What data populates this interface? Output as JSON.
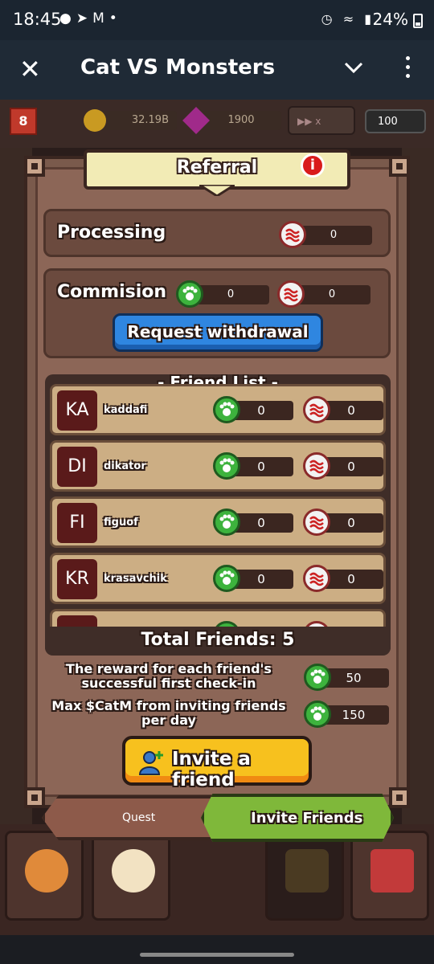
{
  "status_bar": {
    "time": "18:45",
    "battery": "24%"
  },
  "app_bar": {
    "title": "Cat VS Monsters"
  },
  "hud": {
    "level": "8",
    "coins": "32.19B",
    "gems": "1900",
    "speed": "x",
    "energy": "100"
  },
  "referral": {
    "title": "Referral",
    "info": "i",
    "processing_label": "Processing",
    "processing_value": "0",
    "commission_label": "Commision",
    "commission_green": "0",
    "commission_red": "0",
    "withdraw_button": "Request withdrawal",
    "friend_list_title": "- Friend List -",
    "friends": [
      {
        "initials": "KA",
        "name": "kaddafi",
        "green": "0",
        "red": "0"
      },
      {
        "initials": "DI",
        "name": "dikator",
        "green": "0",
        "red": "0"
      },
      {
        "initials": "FI",
        "name": "figuof",
        "green": "0",
        "red": "0"
      },
      {
        "initials": "KR",
        "name": "krasavchik",
        "green": "0",
        "red": "0"
      }
    ],
    "total_friends": "Total Friends: 5",
    "reward_each_label": "The reward for each friend's successful first check-in",
    "reward_each_value": "50",
    "max_label": "Max $CatM from inviting friends per day",
    "max_value": "150",
    "invite_button": "Invite a friend"
  },
  "tabs": {
    "quest": "Quest",
    "invite": "Invite Friends"
  },
  "close_glyph": "✕",
  "colors": {
    "accent_green": "#7fb83a",
    "accent_blue": "#2f86e0",
    "accent_yellow": "#f7c11e"
  }
}
